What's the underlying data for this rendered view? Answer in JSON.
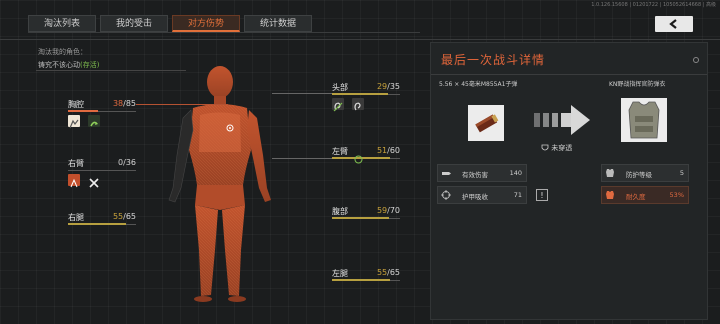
{
  "version_text": "1.0.126.15608 | 01201722 | 105052614668 | 高级",
  "tabs": [
    {
      "label": "淘汰列表",
      "active": false
    },
    {
      "label": "我的受击",
      "active": false
    },
    {
      "label": "对方伤势",
      "active": true
    },
    {
      "label": "统计数据",
      "active": false
    }
  ],
  "victim": {
    "label": "淘汰我的角色：",
    "status_prefix": "铸究不该心动",
    "status_suffix": "(存活)"
  },
  "body_parts": {
    "chest": {
      "name": "胸腔",
      "current": "38",
      "max": "/85",
      "fraction": 0.447,
      "state": "red"
    },
    "right_arm": {
      "name": "右臂",
      "current": "0",
      "max": "/36",
      "fraction": 0,
      "state": "gray"
    },
    "right_leg": {
      "name": "右腿",
      "current": "55",
      "max": "/65",
      "fraction": 0.846,
      "state": "yellow"
    },
    "head": {
      "name": "头部",
      "current": "29",
      "max": "/35",
      "fraction": 0.829,
      "state": "yellow"
    },
    "left_arm": {
      "name": "左臂",
      "current": "51",
      "max": "/60",
      "fraction": 0.85,
      "state": "yellow"
    },
    "abdomen": {
      "name": "腹部",
      "current": "59",
      "max": "/70",
      "fraction": 0.843,
      "state": "yellow"
    },
    "left_leg": {
      "name": "左腿",
      "current": "55",
      "max": "/65",
      "fraction": 0.846,
      "state": "yellow"
    }
  },
  "fight_detail": {
    "title": "最后一次战斗详情",
    "weapon_name": "5.56 × 45毫米M855A1子弹",
    "armor_name": "KN野战指挥官防弹衣",
    "penetration": "未穿透",
    "stats_left": [
      {
        "label": "有效伤害",
        "value": "140",
        "icon": "bullet-damage-icon"
      },
      {
        "label": "护甲吸收",
        "value": "71",
        "icon": "crosshair-icon"
      }
    ],
    "stats_right": [
      {
        "label": "防护等级",
        "value": "5",
        "icon": "vest-icon"
      },
      {
        "label": "耐久度",
        "value": "53%",
        "icon": "durability-icon"
      }
    ],
    "warn_symbol": "!"
  },
  "colors": {
    "accent": "#e2703a",
    "health_yellow": "#b7a040",
    "health_red": "#e06a40"
  }
}
